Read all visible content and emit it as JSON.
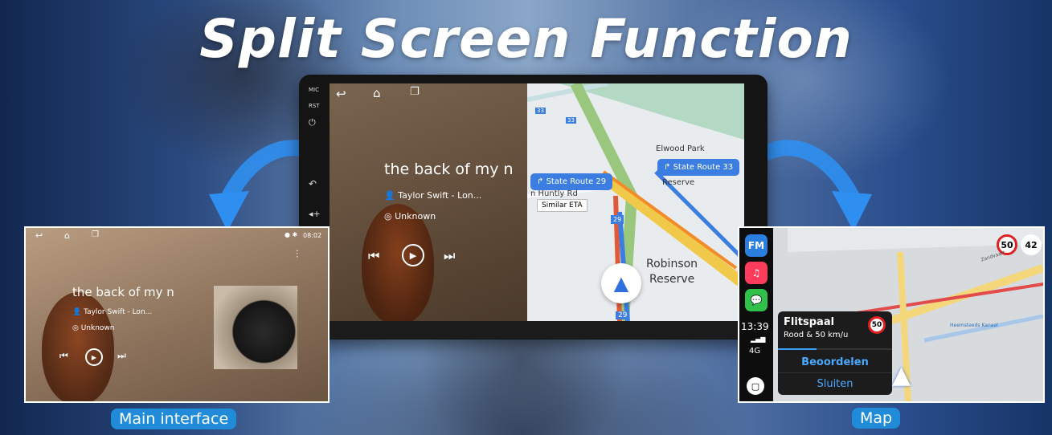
{
  "banner_title": "Split Screen Function",
  "head_unit": {
    "side_buttons": [
      "MIC",
      "RST"
    ],
    "music": {
      "song": "the back of my n",
      "artist": "Taylor Swift - Lon...",
      "album": "Unknown"
    },
    "map": {
      "route_left": "State Route 29",
      "route_right": "State Route 33",
      "eta_tag": "Similar ETA",
      "place1": "Elwood Park",
      "place2": "Reserve",
      "place3": "Robinson",
      "place4": "Reserve",
      "road_partial": "n Huntly Rd",
      "shield_top": "33",
      "shield_mid": "33",
      "shield_29": "29",
      "shield_29b": "29"
    }
  },
  "main_panel": {
    "time": "08:02",
    "song": "the back of my n",
    "artist": "Taylor Swift - Lon...",
    "album": "Unknown",
    "caption": "Main interface"
  },
  "map_panel": {
    "apps": [
      "FM",
      "♫",
      "💬"
    ],
    "clock": "13:39",
    "signal": "4G",
    "speed_sign": "50",
    "speed_current": "42",
    "alert_title": "Flitspaal",
    "alert_sub": "Rood & 50 km/u",
    "alert_sign": "50",
    "btn_rate": "Beoordelen",
    "btn_close": "Sluiten",
    "street1": "Zandvaart",
    "street2": "Heemsteeds Kanaal",
    "caption": "Map"
  }
}
